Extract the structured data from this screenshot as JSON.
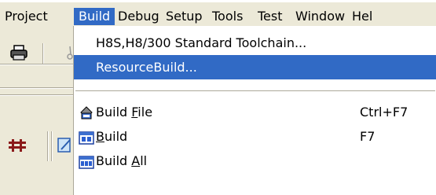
{
  "menubar": {
    "items": [
      {
        "label": "Project"
      },
      {
        "label": "Build"
      },
      {
        "label": "Debug"
      },
      {
        "label": "Setup"
      },
      {
        "label": "Tools"
      },
      {
        "label": "Test"
      },
      {
        "label": "Window"
      },
      {
        "label": "Hel"
      }
    ]
  },
  "dropdown": {
    "items": [
      {
        "label": "H8S,H8/300 Standard Toolchain...",
        "shortcut": ""
      },
      {
        "label": "ResourceBuild...",
        "shortcut": ""
      },
      {
        "label_pre": "Build ",
        "label_ul": "F",
        "label_post": "ile",
        "shortcut": "Ctrl+F7",
        "icon": "build-file-icon"
      },
      {
        "label_pre": "",
        "label_ul": "B",
        "label_post": "uild",
        "shortcut": "F7",
        "icon": "build-icon"
      },
      {
        "label_pre": "Build ",
        "label_ul": "A",
        "label_post": "ll",
        "shortcut": "",
        "icon": "build-all-icon"
      }
    ]
  },
  "toolbar": {
    "icons": [
      "printer-icon",
      "cut-icon",
      "toolbar-tool-icon",
      "toolbar-edit-icon"
    ]
  },
  "colors": {
    "highlight": "#316ac5",
    "menubar_bg": "#ece9d8",
    "menu_bg": "#ffffff"
  }
}
